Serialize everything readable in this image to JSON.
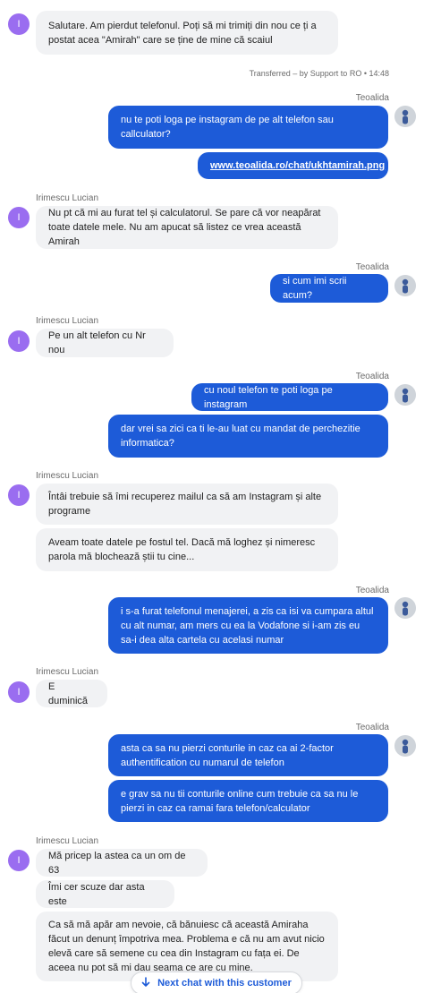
{
  "conversation": {
    "m1": "Salutare. Am pierdut telefonul. Poți să mi trimiți din nou ce ți a postat acea \"Amirah\" care se ține de mine că scaiul",
    "transfer_note": "Transferred – by Support to RO • 14:48",
    "agent_name_1": "Teoalida",
    "m2": "nu te poti loga pe instagram de pe alt telefon sau callculator?",
    "m3": "www.teoalida.ro/chat/ukhtamirah.png",
    "customer_name_1": "Irimescu Lucian",
    "m4": "Nu pt că mi au furat tel și calculatorul. Se pare că vor neapărat toate datele mele. Nu am apucat să listez ce vrea această Amirah",
    "agent_name_2": "Teoalida",
    "m5": "si cum imi scrii acum?",
    "customer_name_2": "Irimescu Lucian",
    "m6": "Pe un alt telefon cu Nr nou",
    "agent_name_3": "Teoalida",
    "m7": "cu noul telefon te poti loga pe instagram",
    "m8": "dar vrei sa zici ca ti le-au luat cu mandat de perchezitie informatica?",
    "customer_name_3": "Irimescu Lucian",
    "m9": "Întâi trebuie să îmi recuperez mailul ca să am Instagram și alte programe",
    "m10": "Aveam toate datele pe fostul tel. Dacă mă loghez și nimeresc parola mă blochează știi tu cine...",
    "agent_name_4": "Teoalida",
    "m11": "i s-a furat telefonul menajerei, a zis ca isi va cumpara altul cu alt numar, am mers cu ea la Vodafone si i-am zis eu sa-i dea alta cartela cu acelasi numar",
    "customer_name_4": "Irimescu Lucian",
    "m12": "E duminică",
    "agent_name_5": "Teoalida",
    "m13": "asta ca sa nu pierzi conturile in caz ca ai 2-factor authentification cu numarul de telefon",
    "m14": "e grav sa nu tii conturile online cum trebuie ca sa nu le pierzi in caz ca ramai fara telefon/calculator",
    "customer_name_5": "Irimescu Lucian",
    "m15": "Mă pricep la astea ca un om de 63",
    "m16": "Îmi cer scuze dar asta este",
    "m17": "Ca să mă apăr am nevoie, că bănuiesc că această Amiraha făcut un denunț împotriva mea. Problema e că nu am avut nicio elevă care să semene cu cea din Instagram cu fața ei. De aceea nu pot să mi dau seama ce are cu mine.",
    "customer_initial": "I"
  },
  "footer": {
    "next_chat_label": "Next chat with this customer",
    "next_chat_icon": "arrow-down-icon"
  },
  "colors": {
    "outgoing_bubble": "#1d5bd8",
    "incoming_bubble": "#f1f2f4",
    "customer_avatar": "#9a6df0",
    "link_accent": "#1d5bd8"
  }
}
